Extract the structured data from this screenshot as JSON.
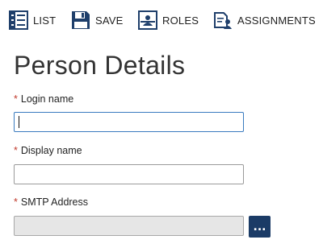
{
  "toolbar": {
    "list": {
      "label": "LIST",
      "icon": "list-icon"
    },
    "save": {
      "label": "SAVE",
      "icon": "save-icon"
    },
    "roles": {
      "label": "ROLES",
      "icon": "roles-icon"
    },
    "assignments": {
      "label": "ASSIGNMENTS",
      "icon": "assignments-icon"
    }
  },
  "page": {
    "title": "Person Details"
  },
  "form": {
    "required_marker": "*",
    "login_name": {
      "label": "Login name",
      "value": ""
    },
    "display_name": {
      "label": "Display name",
      "value": ""
    },
    "smtp_address": {
      "label": "SMTP Address",
      "value": "",
      "lookup_button": "..."
    }
  },
  "colors": {
    "required": "#c0392b",
    "focus_border": "#3a7bbf",
    "lookup_button": "#1b3b66",
    "icon_dark": "#1f3f6b"
  }
}
